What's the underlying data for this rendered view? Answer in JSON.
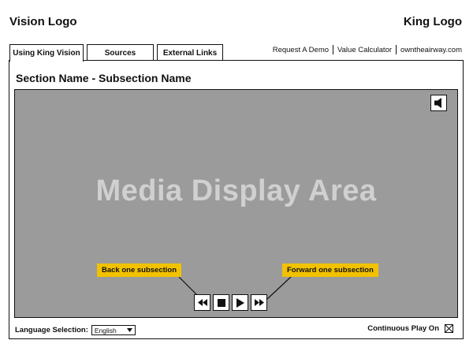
{
  "header": {
    "left_logo": "Vision Logo",
    "right_logo": "King Logo"
  },
  "tabs": [
    {
      "label": "Using King Vision",
      "active": true
    },
    {
      "label": "Sources",
      "active": false
    },
    {
      "label": "External Links",
      "active": false
    }
  ],
  "top_links": [
    "Request A Demo",
    "Value Calculator",
    "owntheairway.com"
  ],
  "section": {
    "title": "Section Name - Subsection Name"
  },
  "media": {
    "label": "Media Display Area",
    "sound_icon": "speaker-icon"
  },
  "callouts": {
    "back": "Back one subsection",
    "forward": "Forward one subsection",
    "color": "#f2c200"
  },
  "controls": [
    "rewind-icon",
    "stop-icon",
    "play-icon",
    "fast-forward-icon"
  ],
  "footer": {
    "language_label": "Language Selection:",
    "language_value": "English",
    "continuous_label": "Continuous Play On",
    "continuous_checked": true
  }
}
